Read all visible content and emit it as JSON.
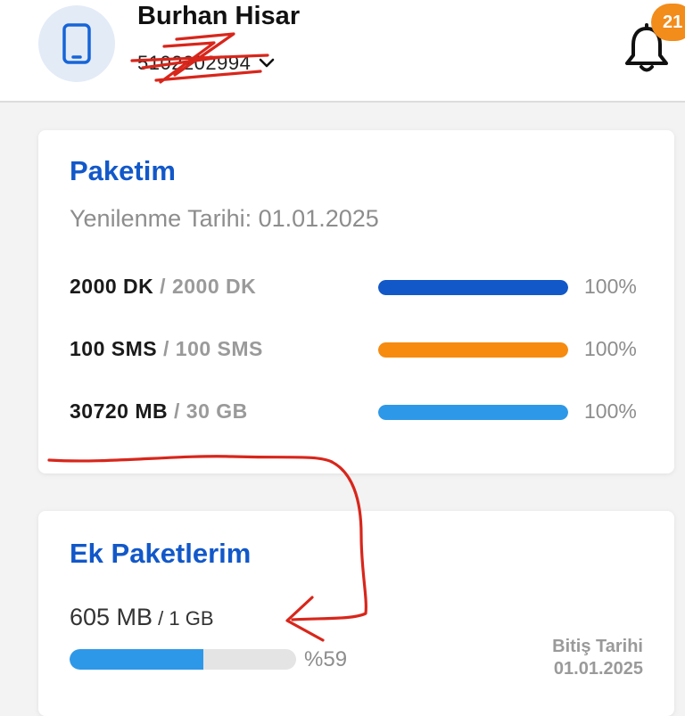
{
  "header": {
    "user_name": "Burhan Hisar",
    "phone_number": "5102202994",
    "notification_count": "21",
    "icons": {
      "avatar": "smartphone-icon",
      "dropdown": "chevron-down-icon",
      "notifications": "bell-icon"
    }
  },
  "package": {
    "title": "Paketim",
    "renewal": "Yenilenme Tarihi: 01.01.2025",
    "rows": [
      {
        "used": "2000 DK",
        "sep": " / ",
        "total": "2000 DK",
        "percent_label": "100%",
        "percent": 100,
        "color": "#1258c9"
      },
      {
        "used": "100 SMS",
        "sep": " / ",
        "total": "100 SMS",
        "percent_label": "100%",
        "percent": 100,
        "color": "#f68b0f"
      },
      {
        "used": "30720 MB",
        "sep": " / ",
        "total": "30 GB",
        "percent_label": "100%",
        "percent": 100,
        "color": "#2e98e8"
      }
    ]
  },
  "extra": {
    "title": "Ek Paketlerim",
    "used": "605 MB",
    "total": " / 1 GB",
    "percent_label": "%59",
    "percent": 59,
    "end_label": "Bitiş Tarihi",
    "end_date": "01.01.2025"
  },
  "colors": {
    "brand_blue": "#1258c9",
    "badge_orange": "#f28c1a",
    "annotation_red": "#d8261b"
  }
}
